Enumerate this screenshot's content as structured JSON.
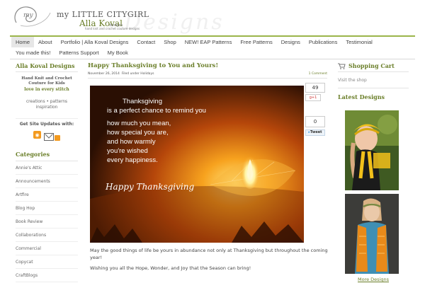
{
  "header": {
    "logo_line1": "my LITTLE CITYGIRL",
    "logo_line2": "Alla Koval",
    "logo_designs": "designs",
    "logo_tagline": "hand knit and crochet couture designs",
    "watermark": "Designs"
  },
  "nav": {
    "row1": [
      "Home",
      "About",
      "Portfolio | Alla Koval Designs",
      "Contact",
      "Shop",
      "NEW! EAP Patterns",
      "Free Patterns",
      "Designs",
      "Publications",
      "Testimonial"
    ],
    "row2": [
      "You made this!",
      "Patterns Support",
      "My Book"
    ],
    "active": "Home"
  },
  "left_sidebar": {
    "title": "Alla Koval Designs",
    "sub1": "Hand Knit and Crochet Couture for Kids",
    "sub2": "love in every stitch",
    "sub3": "creations • patterns inspiration",
    "updates_label": "Get Site Updates with:",
    "categories_title": "Categories",
    "categories": [
      "Annie's Attic",
      "Announcements",
      "Artfire",
      "Blog Hop",
      "Book Review",
      "Collaborations",
      "Commercial",
      "Copycat",
      "CraftBlogs",
      "Creations"
    ]
  },
  "post": {
    "title": "Happy Thanksgiving to You and Yours!",
    "date": "November 26, 2014",
    "filed": "Filed under Holidays",
    "comments": "1 Comment",
    "hero_lines": [
      "Thanksgiving",
      "is a perfect chance to remind you",
      "how much you mean,",
      "how special you are,",
      "and how warmly",
      "you're wished",
      "every happiness."
    ],
    "hero_happy": "Happy Thanksgiving",
    "paragraph1": "May the good things of life be yours in abundance not only at Thanksgiving but throughout the coming year!",
    "paragraph2": "Wishing you all the Hope, Wonder, and Joy that the Season can bring!"
  },
  "share": {
    "gplus_count": "49",
    "gplus_label": "g+1",
    "tweet_count": "0",
    "tweet_label": "Tweet"
  },
  "right_sidebar": {
    "cart_title": "Shopping Cart",
    "visit_shop": "Visit the shop",
    "latest_title": "Latest Designs",
    "more_designs": "More Designs"
  },
  "colors": {
    "accent": "#6b7f2a",
    "nav_rule": "#9bb54a",
    "hero_bg": "#3b1a06"
  }
}
